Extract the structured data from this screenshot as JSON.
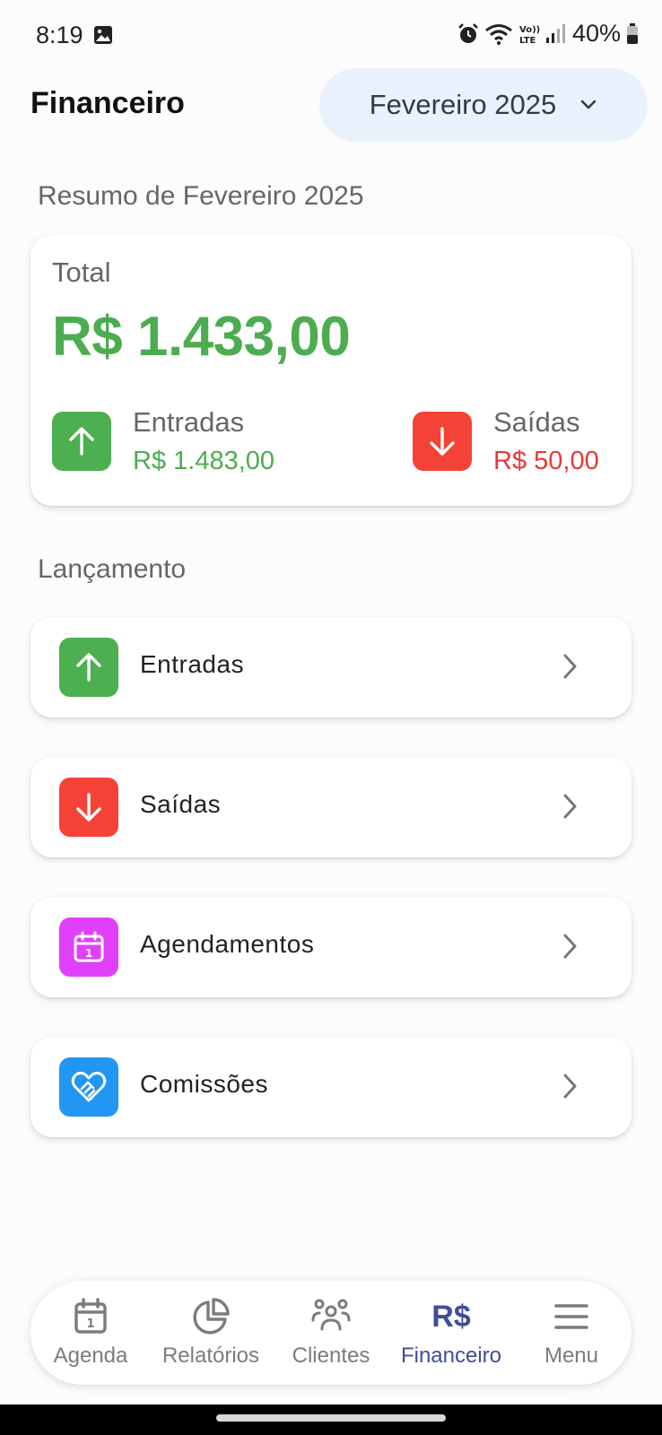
{
  "status_bar": {
    "time": "8:19",
    "battery": "40%",
    "volte": "Vo)) LTE"
  },
  "header": {
    "title": "Financeiro",
    "month": "Fevereiro 2025"
  },
  "summary": {
    "section_title": "Resumo de Fevereiro 2025",
    "total_label": "Total",
    "total_value": "R$ 1.433,00",
    "income_label": "Entradas",
    "income_value": "R$ 1.483,00",
    "expense_label": "Saídas",
    "expense_value": "R$ 50,00"
  },
  "launch": {
    "section_title": "Lançamento",
    "items": [
      {
        "label": "Entradas",
        "icon": "arrow-up-icon",
        "color": "#4caf50"
      },
      {
        "label": "Saídas",
        "icon": "arrow-down-icon",
        "color": "#f44336"
      },
      {
        "label": "Agendamentos",
        "icon": "calendar-icon",
        "color": "#e040fb"
      },
      {
        "label": "Comissões",
        "icon": "heart-handshake-icon",
        "color": "#2196f3"
      }
    ]
  },
  "bottom_nav": {
    "items": [
      {
        "label": "Agenda",
        "icon": "calendar-icon"
      },
      {
        "label": "Relatórios",
        "icon": "pie-chart-icon"
      },
      {
        "label": "Clientes",
        "icon": "people-icon"
      },
      {
        "label": "Financeiro",
        "icon": "currency-icon",
        "glyph": "R$",
        "active": true
      },
      {
        "label": "Menu",
        "icon": "menu-icon"
      }
    ]
  },
  "colors": {
    "green": "#4cad50",
    "red": "#e53935",
    "active_nav": "#3f4d9b",
    "month_pill": "#e8f1fc"
  }
}
